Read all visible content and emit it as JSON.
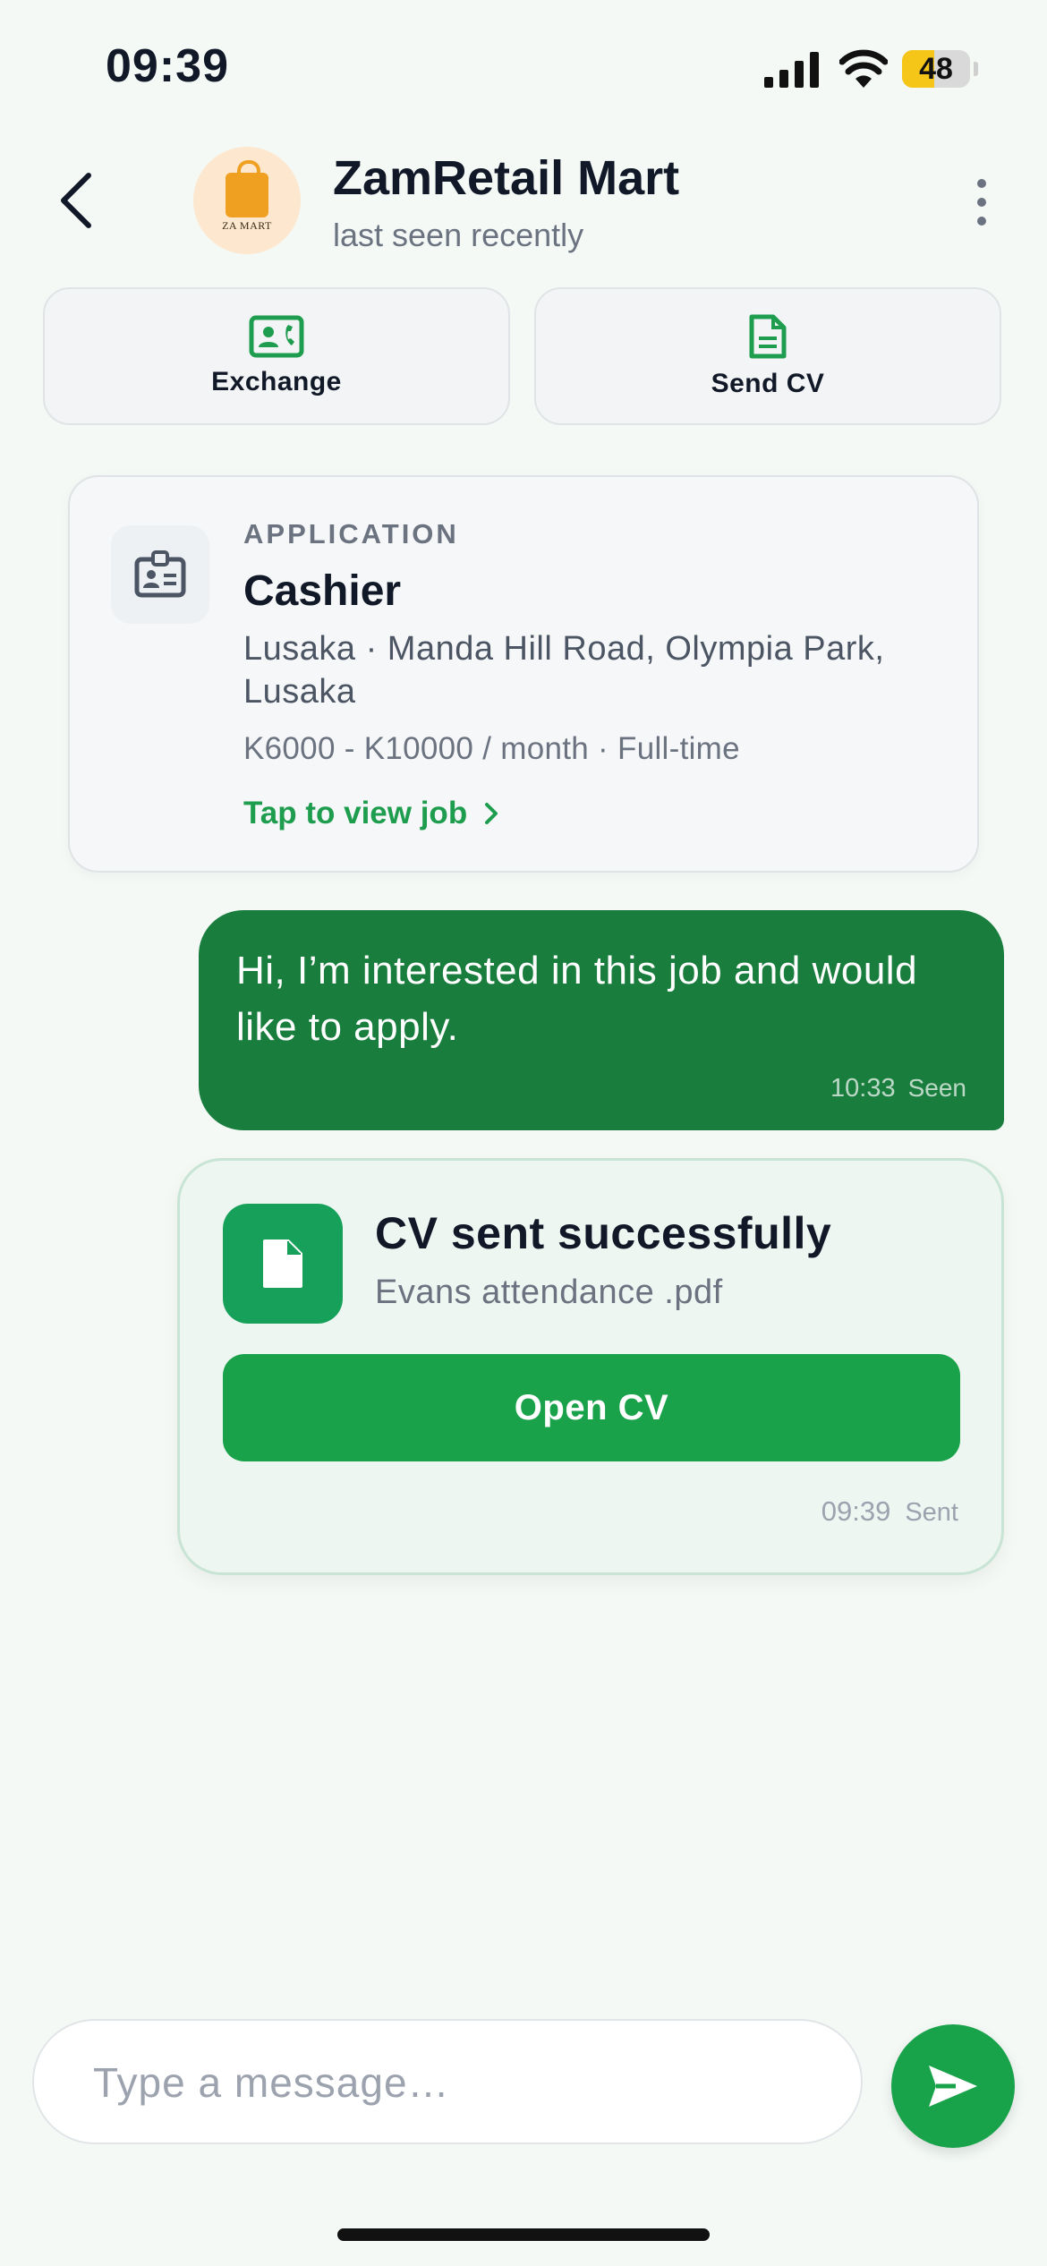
{
  "status_bar": {
    "time": "09:39",
    "battery": "48",
    "battery_level": 0.48
  },
  "header": {
    "contact_name": "ZamRetail Mart",
    "contact_status": "last seen recently",
    "avatar_logo_text": "ZA MART"
  },
  "actions": [
    {
      "label": "Exchange",
      "icon": "contact-card-phone-icon"
    },
    {
      "label": "Send CV",
      "icon": "document-icon"
    }
  ],
  "application": {
    "eyebrow": "APPLICATION",
    "title": "Cashier",
    "location": "Lusaka · Manda Hill Road, Olympia Park, Lusaka",
    "salary": "K6000 - K10000 / month · Full-time",
    "link_label": "Tap to view job",
    "icon": "id-badge-icon"
  },
  "messages": [
    {
      "text": "Hi, I’m interested in this job and would like to apply.",
      "time": "10:33",
      "status": "Seen"
    }
  ],
  "cv_card": {
    "title": "CV sent successfully",
    "filename": "Evans attendance .pdf",
    "button_label": "Open CV",
    "time": "09:39",
    "status": "Sent"
  },
  "composer": {
    "placeholder": "Type a message…",
    "value": ""
  },
  "colors": {
    "primary_green": "#19a24a",
    "dark_green": "#197e3d",
    "background": "#f4f9f6"
  }
}
